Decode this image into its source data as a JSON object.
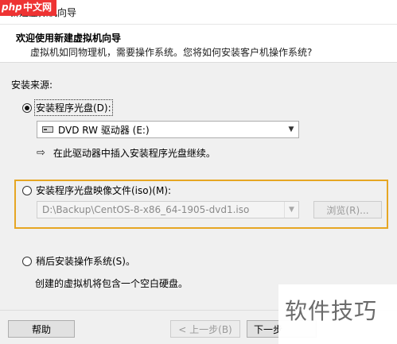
{
  "window": {
    "title": "新建虚拟机向导"
  },
  "watermark": {
    "php_logo": "php",
    "php_cn": "中文网",
    "corner_text": "软件技巧"
  },
  "header": {
    "heading": "欢迎使用新建虚拟机向导",
    "subtitle": "虚拟机如同物理机，需要操作系统。您将如何安装客户机操作系统?"
  },
  "source": {
    "label": "安装来源:",
    "options": [
      {
        "label": "安装程序光盘(D):",
        "checked": true
      },
      {
        "label": "安装程序光盘映像文件(iso)(M):",
        "checked": false
      },
      {
        "label": "稍后安装操作系统(S)。",
        "checked": false
      }
    ],
    "disc": {
      "drive_value": "DVD RW 驱动器 (E:)",
      "hint": "在此驱动器中插入安装程序光盘继续。"
    },
    "iso": {
      "path_value": "D:\\Backup\\CentOS-8-x86_64-1905-dvd1.iso",
      "browse_label": "浏览(R)..."
    },
    "later": {
      "description": "创建的虚拟机将包含一个空白硬盘。"
    }
  },
  "footer": {
    "help_label": "帮助",
    "back_label": "< 上一步(B)",
    "next_label": "下一步"
  },
  "colors": {
    "highlight_border": "#e6a623"
  }
}
